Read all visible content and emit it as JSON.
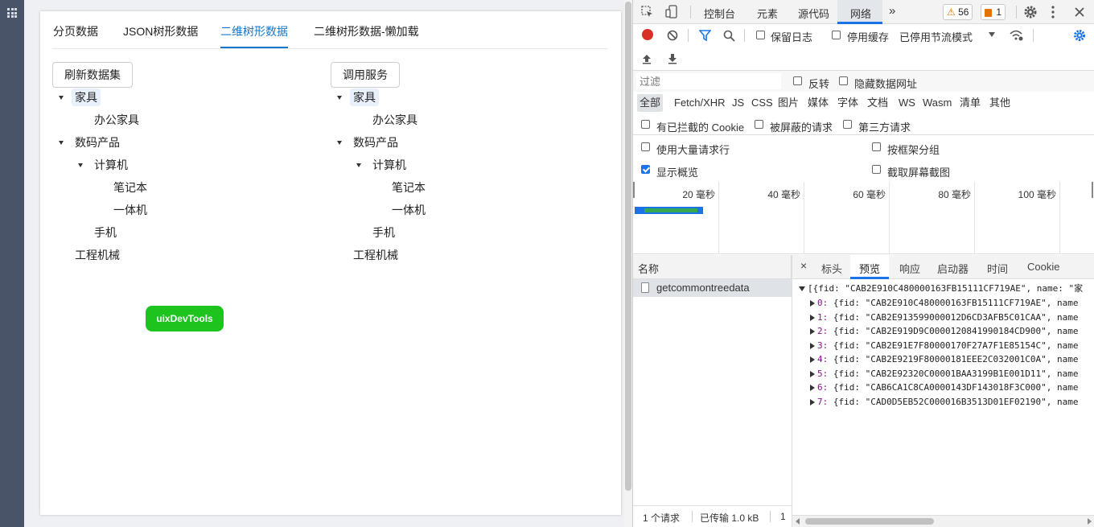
{
  "app": {
    "tabs": [
      {
        "label": "分页数据"
      },
      {
        "label": "JSON树形数据"
      },
      {
        "label": "二维树形数据"
      },
      {
        "label": "二维树形数据-懒加载"
      }
    ],
    "active_tab": 2,
    "refresh_button": "刷新数据集",
    "call_service_button": "调用服务",
    "tree_left": {
      "n1": "家具",
      "n2": "办公家具",
      "n3": "数码产品",
      "n4": "计算机",
      "n5": "笔记本",
      "n6": "一体机",
      "n7": "手机",
      "n8": "工程机械"
    },
    "tree_right": {
      "n1": "家具",
      "n2": "办公家具",
      "n3": "数码产品",
      "n4": "计算机",
      "n5": "笔记本",
      "n6": "一体机",
      "n7": "手机",
      "n8": "工程机械"
    },
    "devtools_button": "uixDevTools"
  },
  "devtools": {
    "tabs": {
      "console": "控制台",
      "elements": "元素",
      "sources": "源代码",
      "network": "网络",
      "more": "»"
    },
    "warnings_count": "56",
    "issues_count": "1",
    "toolbar": {
      "preserve_log": "保留日志",
      "disable_cache": "停用缓存",
      "throttling": "已停用节流模式"
    },
    "filter": {
      "placeholder": "过滤",
      "invert": "反转",
      "hide_data_urls": "隐藏数据网址"
    },
    "types": [
      "全部",
      "Fetch/XHR",
      "JS",
      "CSS",
      "图片",
      "媒体",
      "字体",
      "文档",
      "WS",
      "Wasm",
      "清单",
      "其他"
    ],
    "blocked": {
      "blocked_cookies": "有已拦截的 Cookie",
      "blocked_requests": "被屏蔽的请求",
      "third_party": "第三方请求"
    },
    "options": {
      "large_rows": "使用大量请求行",
      "group_by_frame": "按框架分组",
      "show_overview": "显示概览",
      "capture_screenshots": "截取屏幕截图"
    },
    "timeline_labels": [
      "20 毫秒",
      "40 毫秒",
      "60 毫秒",
      "80 毫秒",
      "100 毫秒"
    ],
    "name_header": "名称",
    "request_name": "getcommontreedata",
    "status": {
      "requests": "1 个请求",
      "transferred": "已传输 1.0 kB",
      "more": "1"
    },
    "detail_tabs": {
      "close": "×",
      "headers": "标头",
      "preview": "预览",
      "response": "响应",
      "initiator": "启动器",
      "timing": "时间",
      "cookie": "Cookie"
    },
    "json_preview": {
      "root": "[{fid: \"CAB2E910C480000163FB15111CF719AE\", name: \"家",
      "items": [
        {
          "idx": "0:",
          "text": " {fid: \"CAB2E910C480000163FB15111CF719AE\", name"
        },
        {
          "idx": "1:",
          "text": " {fid: \"CAB2E913599000012D6CD3AFB5C01CAA\", name"
        },
        {
          "idx": "2:",
          "text": " {fid: \"CAB2E919D9C0000120841990184CD900\", name"
        },
        {
          "idx": "3:",
          "text": " {fid: \"CAB2E91E7F80000170F27A7F1E85154C\", name"
        },
        {
          "idx": "4:",
          "text": " {fid: \"CAB2E9219F80000181EEE2C032001C0A\", name"
        },
        {
          "idx": "5:",
          "text": " {fid: \"CAB2E92320C00001BAA3199B1E001D11\", name"
        },
        {
          "idx": "6:",
          "text": " {fid: \"CAB6CA1C8CA0000143DF143018F3C000\", name"
        },
        {
          "idx": "7:",
          "text": " {fid: \"CAD0D5EB52C000016B3513D01EF02190\", name"
        }
      ]
    }
  }
}
